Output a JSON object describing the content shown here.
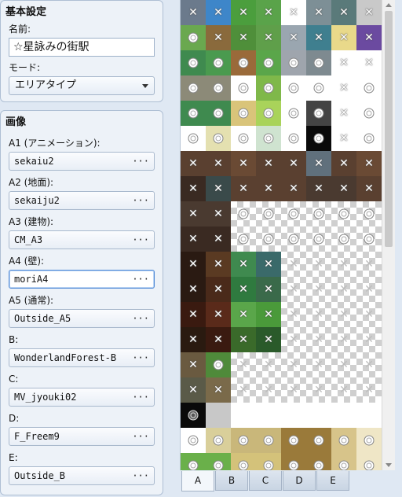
{
  "basic": {
    "title": "基本設定",
    "name_label": "名前:",
    "name_value": "☆星詠みの街駅",
    "mode_label": "モード:",
    "mode_value": "エリアタイプ"
  },
  "images": {
    "title": "画像",
    "dots": "···",
    "slots": [
      {
        "label": "A1 (アニメーション):",
        "value": "sekaiu2"
      },
      {
        "label": "A2 (地面):",
        "value": "sekaiju2"
      },
      {
        "label": "A3 (建物):",
        "value": "CM_A3"
      },
      {
        "label": "A4 (壁):",
        "value": "moriA4"
      },
      {
        "label": "A5 (通常):",
        "value": "Outside_A5"
      },
      {
        "label": "B:",
        "value": "WonderlandForest-B"
      },
      {
        "label": "C:",
        "value": "MV_jyouki02"
      },
      {
        "label": "D:",
        "value": "F_Freem9"
      },
      {
        "label": "E:",
        "value": "Outside_B"
      }
    ]
  },
  "tabs": [
    "A",
    "B",
    "C",
    "D",
    "E"
  ],
  "active_tab": "A",
  "colors": {
    "panel_bg": "#edf2f8",
    "selected_border": "#4f89d6",
    "window_bg": "#dfe8f3"
  }
}
